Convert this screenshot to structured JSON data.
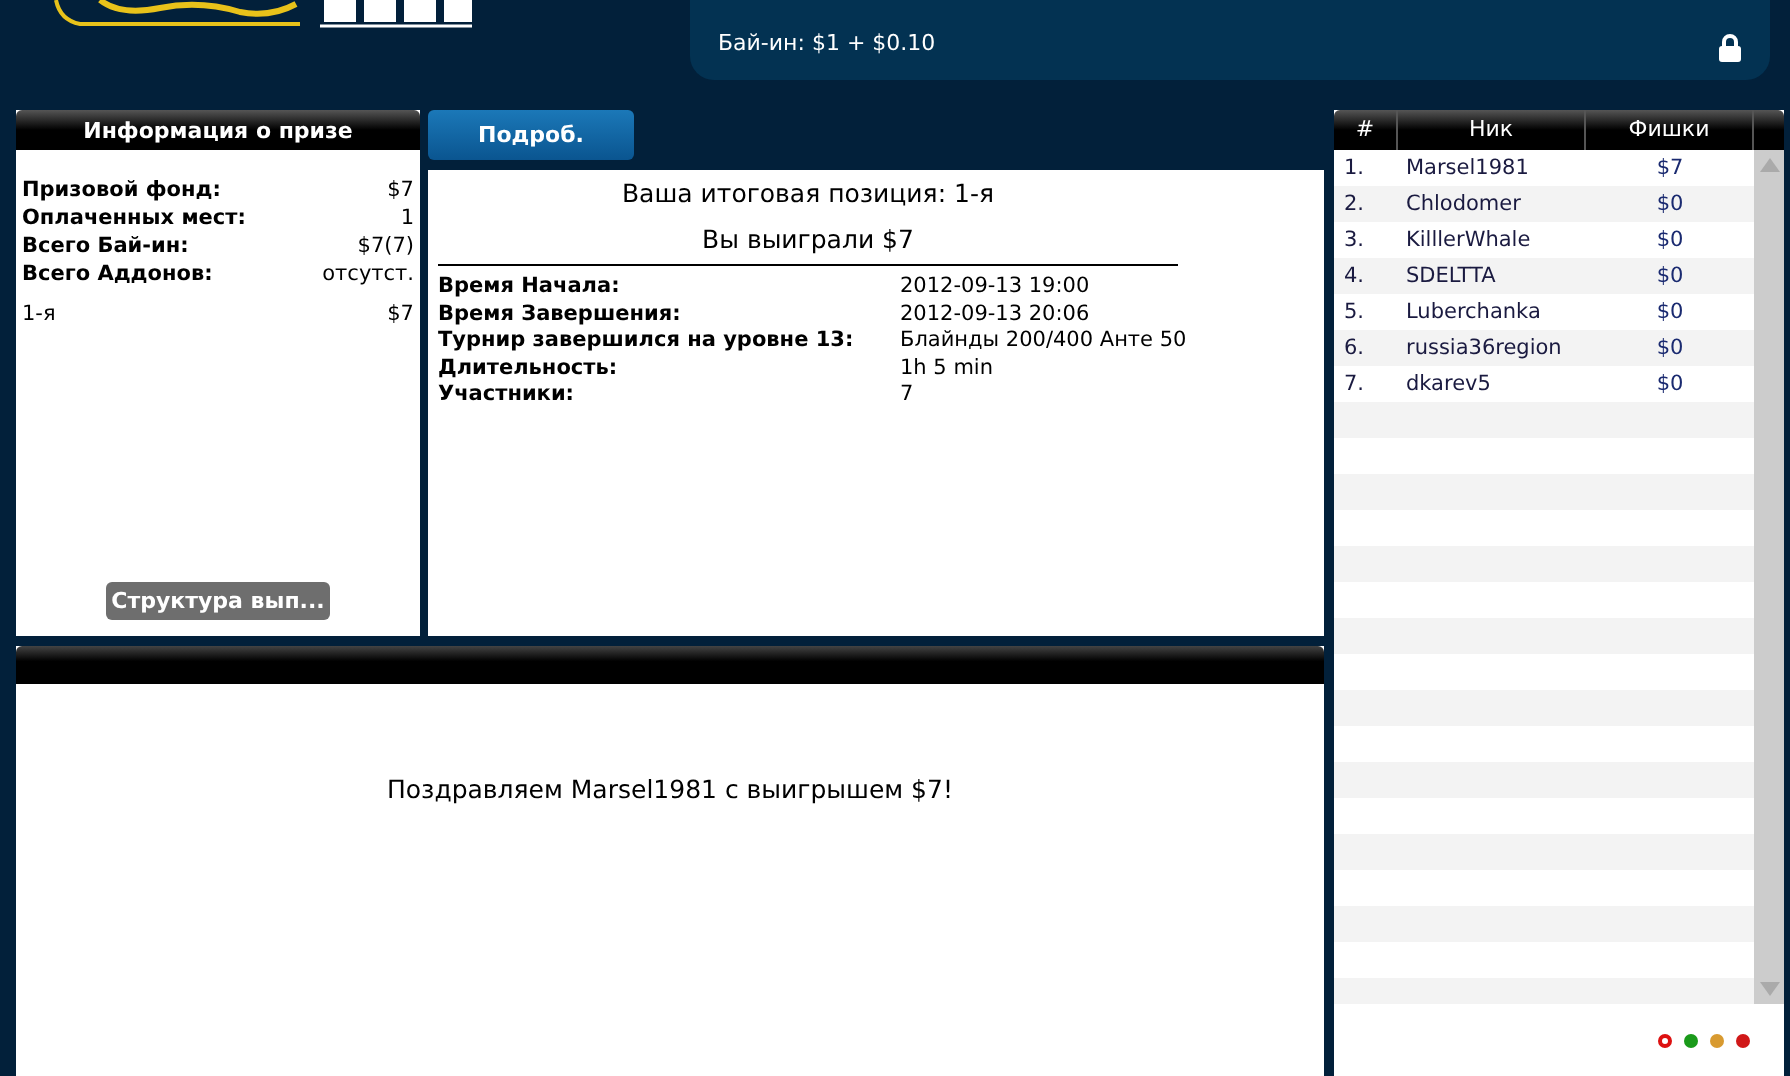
{
  "header": {
    "buy_in": "Бай-ин: $1 + $0.10",
    "locked": true
  },
  "prize_info": {
    "title": "Информация о призе",
    "rows": [
      {
        "label": "Призовой фонд:",
        "value": "$7"
      },
      {
        "label": "Оплаченных мест:",
        "value": "1"
      },
      {
        "label": "Всего Бай-ин:",
        "value": "$7(7)"
      },
      {
        "label": "Всего Аддонов:",
        "value": "отсутст."
      }
    ],
    "payouts": [
      {
        "place": "1-я",
        "amount": "$7"
      }
    ],
    "structure_button": "Структура вып..."
  },
  "details_tab": {
    "label": "Подроб.",
    "selected": true
  },
  "result": {
    "position": "Ваша итоговая позиция: 1-я",
    "won": "Вы выиграли $7",
    "rows": [
      {
        "label": "Время Начала:",
        "value": "2012-09-13 19:00"
      },
      {
        "label": "Время Завершения:",
        "value": "2012-09-13 20:06"
      },
      {
        "label": "Турнир завершился на уровне 13:",
        "value": "Блайнды 200/400 Анте 50"
      },
      {
        "label": "Длительность:",
        "value": "1h 5 min"
      },
      {
        "label": "Участники:",
        "value": "7"
      }
    ]
  },
  "message": "Поздравляем Marsel1981 с выигрышем $7!",
  "players": {
    "columns": [
      "#",
      "Ник",
      "Фишки"
    ],
    "rows": [
      {
        "rank": "1.",
        "nick": "Marsel1981",
        "chips": "$7"
      },
      {
        "rank": "2.",
        "nick": "Chlodomer",
        "chips": "$0"
      },
      {
        "rank": "3.",
        "nick": "KilllerWhale",
        "chips": "$0"
      },
      {
        "rank": "4.",
        "nick": "SDELTTA",
        "chips": "$0"
      },
      {
        "rank": "5.",
        "nick": "Luberchanka",
        "chips": "$0"
      },
      {
        "rank": "6.",
        "nick": "russia36region",
        "chips": "$0"
      },
      {
        "rank": "7.",
        "nick": "dkarev5",
        "chips": "$0"
      }
    ]
  },
  "status_dots": [
    {
      "color": "#dd1111",
      "kind": "ring"
    },
    {
      "color": "#1a9a1a",
      "kind": "dot"
    },
    {
      "color": "#d89a30",
      "kind": "dot"
    },
    {
      "color": "#d01818",
      "kind": "dot"
    }
  ]
}
